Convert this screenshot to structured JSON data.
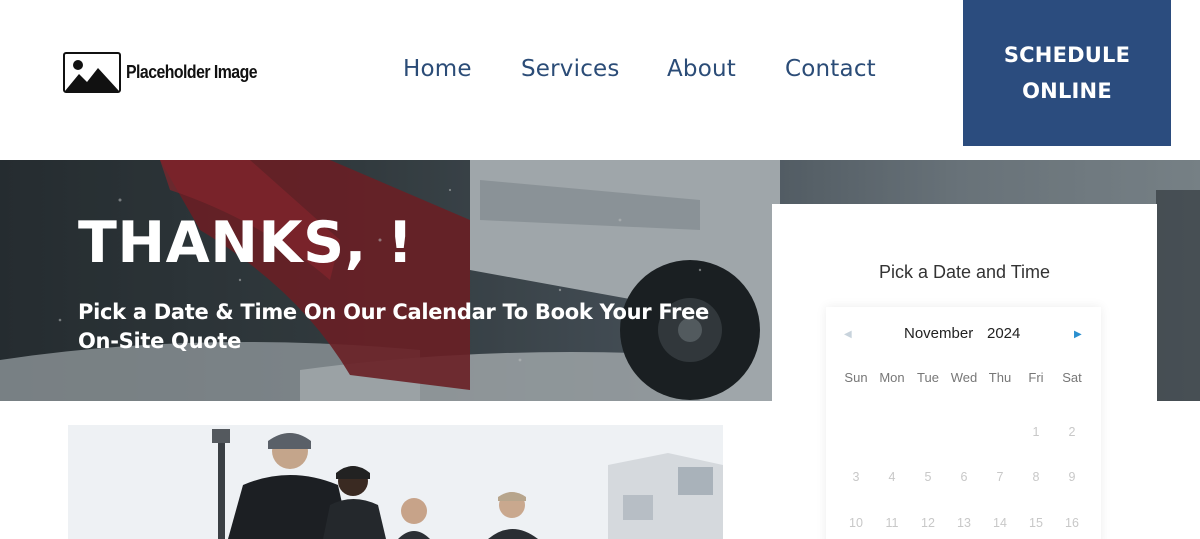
{
  "header": {
    "logo_text": "Placeholder Image",
    "nav": [
      "Home",
      "Services",
      "About",
      "Contact"
    ],
    "cta_label": "SCHEDULE ONLINE",
    "cta_color": "#2b4c7e",
    "nav_color": "#2b4c77"
  },
  "hero": {
    "title": "THANKS, !",
    "subtitle": "Pick a Date & Time On Our Calendar To Book Your Free On-Site Quote"
  },
  "booking": {
    "title": "Pick a Date and Time",
    "month": "November",
    "year": "2024",
    "prev_icon": "chevron-left-icon",
    "next_icon": "chevron-right-icon",
    "weekdays": [
      "Sun",
      "Mon",
      "Tue",
      "Wed",
      "Thu",
      "Fri",
      "Sat"
    ],
    "weeks": [
      [
        "",
        "",
        "",
        "",
        "",
        "1",
        "2"
      ],
      [
        "3",
        "4",
        "5",
        "6",
        "7",
        "8",
        "9"
      ],
      [
        "10",
        "11",
        "12",
        "13",
        "14",
        "15",
        "16"
      ]
    ]
  }
}
